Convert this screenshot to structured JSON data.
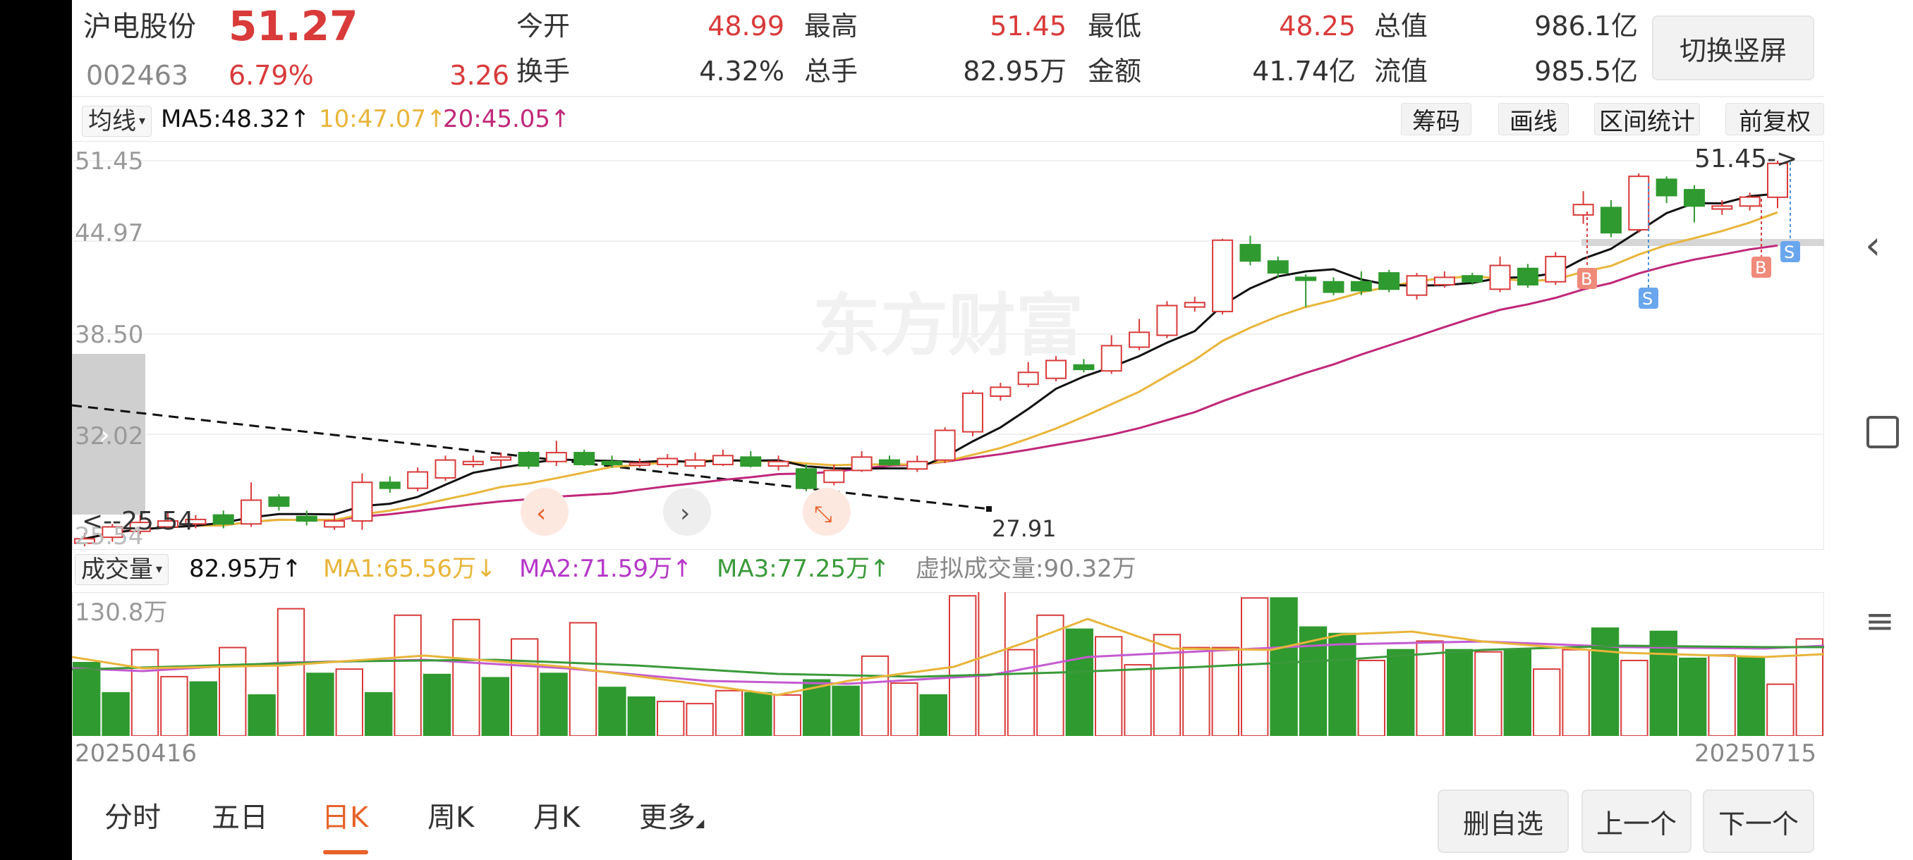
{
  "quote": {
    "name": "沪电股份",
    "price": "51.27",
    "code": "002463",
    "change_pct": "6.79%",
    "change_amt": "3.26",
    "stats": [
      {
        "label": "今开",
        "value": "48.99"
      },
      {
        "label": "最高",
        "value": "51.45"
      },
      {
        "label": "最低",
        "value": "48.25"
      },
      {
        "label": "总值",
        "value": "986.1亿"
      },
      {
        "label": "换手",
        "value": "4.32%"
      },
      {
        "label": "总手",
        "value": "82.95万"
      },
      {
        "label": "金额",
        "value": "41.74亿"
      },
      {
        "label": "流值",
        "value": "985.5亿"
      }
    ],
    "switch_label": "切换竖屏"
  },
  "ma_bar": {
    "selector": "均线",
    "ma5": "MA5:48.32",
    "ma10": "10:47.07",
    "ma20": "20:45.05",
    "buttons": [
      "筹码",
      "画线",
      "区间统计",
      "前复权"
    ]
  },
  "kline": {
    "axis": [
      "51.45",
      "44.97",
      "38.50",
      "32.02",
      "25.54"
    ],
    "high_label": "51.45->",
    "low_label": "<--25.54",
    "trend_end_label": "27.91",
    "watermark": "东方财富",
    "signals": [
      "B",
      "S",
      "B",
      "S"
    ]
  },
  "volume": {
    "selector": "成交量",
    "current": "82.95万",
    "ma1": "MA1:65.56万",
    "ma2": "MA2:71.59万",
    "ma3": "MA3:77.25万",
    "virtual": "虚拟成交量:90.32万",
    "axis_max": "130.8万",
    "date_start": "20250416",
    "date_end": "20250715"
  },
  "tabs": [
    "分时",
    "五日",
    "日K",
    "周K",
    "月K",
    "更多"
  ],
  "active_tab": "日K",
  "bottom_buttons": [
    "删自选",
    "上一个",
    "下一个"
  ],
  "colors": {
    "up": "#d93a3a",
    "down": "#2f9a2f",
    "ma5": "#111111",
    "ma10": "#e8b53a",
    "ma20": "#c0287a",
    "accent": "#e8622a"
  },
  "chart_data": {
    "type": "candlestick",
    "x_start": "20250416",
    "x_end": "20250715",
    "ylim": [
      25.54,
      51.45
    ],
    "candles": [
      {
        "o": 25.7,
        "c": 26.0,
        "h": 26.4,
        "l": 25.5
      },
      {
        "o": 26.1,
        "c": 26.8,
        "h": 27.0,
        "l": 25.8
      },
      {
        "o": 26.5,
        "c": 27.1,
        "h": 27.6,
        "l": 26.3
      },
      {
        "o": 26.8,
        "c": 27.2,
        "h": 27.8,
        "l": 26.6
      },
      {
        "o": 27.0,
        "c": 27.3,
        "h": 27.6,
        "l": 26.7
      },
      {
        "o": 27.6,
        "c": 27.0,
        "h": 27.9,
        "l": 26.7
      },
      {
        "o": 27.0,
        "c": 28.6,
        "h": 29.8,
        "l": 26.8
      },
      {
        "o": 28.8,
        "c": 28.2,
        "h": 29.0,
        "l": 27.9
      },
      {
        "o": 27.5,
        "c": 27.2,
        "h": 27.9,
        "l": 26.9
      },
      {
        "o": 26.8,
        "c": 27.2,
        "h": 27.6,
        "l": 26.6
      },
      {
        "o": 27.2,
        "c": 29.8,
        "h": 30.4,
        "l": 26.6
      },
      {
        "o": 29.8,
        "c": 29.4,
        "h": 30.2,
        "l": 29.1
      },
      {
        "o": 29.4,
        "c": 30.5,
        "h": 30.8,
        "l": 29.2
      },
      {
        "o": 30.1,
        "c": 31.3,
        "h": 31.6,
        "l": 29.9
      },
      {
        "o": 31.0,
        "c": 31.2,
        "h": 31.6,
        "l": 30.8
      },
      {
        "o": 31.3,
        "c": 31.5,
        "h": 31.8,
        "l": 30.8
      },
      {
        "o": 31.8,
        "c": 30.9,
        "h": 31.9,
        "l": 30.7
      },
      {
        "o": 31.2,
        "c": 31.8,
        "h": 32.6,
        "l": 30.9
      },
      {
        "o": 31.8,
        "c": 31.0,
        "h": 32.0,
        "l": 30.9
      },
      {
        "o": 31.2,
        "c": 31.0,
        "h": 31.6,
        "l": 30.8
      },
      {
        "o": 31.0,
        "c": 31.1,
        "h": 31.4,
        "l": 30.8
      },
      {
        "o": 31.0,
        "c": 31.4,
        "h": 31.7,
        "l": 30.8
      },
      {
        "o": 30.9,
        "c": 31.3,
        "h": 31.8,
        "l": 30.7
      },
      {
        "o": 31.0,
        "c": 31.6,
        "h": 32.0,
        "l": 30.9
      },
      {
        "o": 31.5,
        "c": 30.9,
        "h": 31.9,
        "l": 30.8
      },
      {
        "o": 30.9,
        "c": 31.2,
        "h": 31.6,
        "l": 30.6
      },
      {
        "o": 30.7,
        "c": 29.4,
        "h": 31.0,
        "l": 29.2
      },
      {
        "o": 29.8,
        "c": 30.6,
        "h": 31.0,
        "l": 29.6
      },
      {
        "o": 30.6,
        "c": 31.5,
        "h": 31.9,
        "l": 30.5
      },
      {
        "o": 31.3,
        "c": 31.0,
        "h": 31.6,
        "l": 30.9
      },
      {
        "o": 30.7,
        "c": 31.2,
        "h": 31.6,
        "l": 30.5
      },
      {
        "o": 31.3,
        "c": 33.3,
        "h": 33.5,
        "l": 31.1
      },
      {
        "o": 33.2,
        "c": 35.8,
        "h": 36.0,
        "l": 32.9
      },
      {
        "o": 35.6,
        "c": 36.2,
        "h": 36.5,
        "l": 35.3
      },
      {
        "o": 36.4,
        "c": 37.2,
        "h": 37.9,
        "l": 36.2
      },
      {
        "o": 36.8,
        "c": 38.0,
        "h": 38.3,
        "l": 36.6
      },
      {
        "o": 37.7,
        "c": 37.4,
        "h": 38.1,
        "l": 37.2
      },
      {
        "o": 37.3,
        "c": 39.0,
        "h": 39.7,
        "l": 37.1
      },
      {
        "o": 38.9,
        "c": 39.9,
        "h": 40.8,
        "l": 38.7
      },
      {
        "o": 39.7,
        "c": 41.7,
        "h": 42.0,
        "l": 39.5
      },
      {
        "o": 41.6,
        "c": 41.9,
        "h": 42.3,
        "l": 41.3
      },
      {
        "o": 41.3,
        "c": 46.1,
        "h": 46.2,
        "l": 41.1
      },
      {
        "o": 45.8,
        "c": 44.7,
        "h": 46.4,
        "l": 44.4
      },
      {
        "o": 44.7,
        "c": 43.9,
        "h": 45.0,
        "l": 43.6
      },
      {
        "o": 43.6,
        "c": 43.4,
        "h": 43.8,
        "l": 41.6
      },
      {
        "o": 43.3,
        "c": 42.6,
        "h": 43.6,
        "l": 42.4
      },
      {
        "o": 43.3,
        "c": 42.7,
        "h": 44.0,
        "l": 42.4
      },
      {
        "o": 43.9,
        "c": 42.8,
        "h": 44.1,
        "l": 42.6
      },
      {
        "o": 42.4,
        "c": 43.7,
        "h": 43.9,
        "l": 42.1
      },
      {
        "o": 43.1,
        "c": 43.6,
        "h": 44.0,
        "l": 42.9
      },
      {
        "o": 43.7,
        "c": 43.3,
        "h": 43.9,
        "l": 43.1
      },
      {
        "o": 42.8,
        "c": 44.4,
        "h": 45.0,
        "l": 42.6
      },
      {
        "o": 44.2,
        "c": 43.1,
        "h": 44.5,
        "l": 42.9
      },
      {
        "o": 43.3,
        "c": 45.0,
        "h": 45.3,
        "l": 43.1
      },
      {
        "o": 47.8,
        "c": 48.5,
        "h": 49.4,
        "l": 47.2
      },
      {
        "o": 48.3,
        "c": 46.6,
        "h": 48.8,
        "l": 46.3
      },
      {
        "o": 46.8,
        "c": 50.4,
        "h": 50.6,
        "l": 46.6
      },
      {
        "o": 50.2,
        "c": 49.1,
        "h": 50.4,
        "l": 48.6
      },
      {
        "o": 49.5,
        "c": 48.4,
        "h": 49.8,
        "l": 47.3
      },
      {
        "o": 48.2,
        "c": 48.4,
        "h": 48.8,
        "l": 47.8
      },
      {
        "o": 48.4,
        "c": 49.0,
        "h": 49.3,
        "l": 48.1
      },
      {
        "o": 48.99,
        "c": 51.27,
        "h": 51.45,
        "l": 48.25
      }
    ],
    "volume_ylim": [
      0,
      130.8
    ],
    "volumes": [
      68,
      40,
      80,
      55,
      50,
      82,
      38,
      118,
      58,
      62,
      40,
      112,
      57,
      108,
      54,
      90,
      58,
      105,
      45,
      36,
      32,
      30,
      42,
      40,
      38,
      52,
      46,
      74,
      49,
      38,
      130,
      140,
      80,
      112,
      99,
      92,
      66,
      94,
      82,
      82,
      128,
      128,
      101,
      95,
      70,
      80,
      88,
      80,
      78,
      80,
      62,
      80,
      100,
      70,
      97,
      72,
      75,
      73,
      48,
      90
    ],
    "volume_up": [
      false,
      false,
      true,
      true,
      false,
      true,
      false,
      true,
      false,
      true,
      false,
      true,
      false,
      true,
      false,
      true,
      false,
      true,
      false,
      false,
      true,
      true,
      true,
      false,
      true,
      false,
      false,
      true,
      true,
      false,
      true,
      true,
      true,
      true,
      false,
      true,
      true,
      true,
      true,
      true,
      true,
      false,
      false,
      false,
      true,
      false,
      true,
      false,
      true,
      false,
      true,
      true,
      false,
      true,
      false,
      false,
      true,
      false,
      true,
      true
    ]
  }
}
